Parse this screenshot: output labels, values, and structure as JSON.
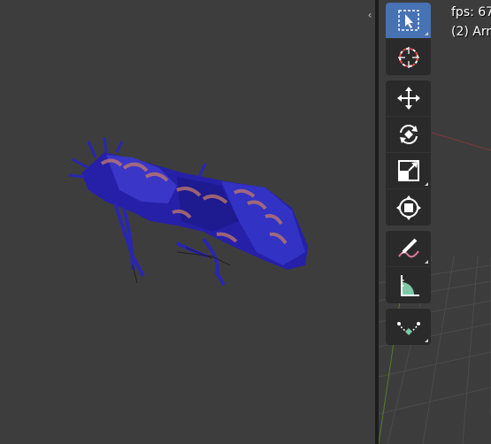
{
  "viewport": {
    "fps_text": "fps: 67",
    "object_text": "(2) Arm"
  },
  "colors": {
    "active_tool": "#4772b3",
    "background": "#3d3d3d",
    "model": "#2a2ab8"
  },
  "toolbar": {
    "tools": [
      {
        "name": "select-box",
        "icon": "select-box-icon",
        "active": true
      },
      {
        "name": "cursor",
        "icon": "cursor-icon",
        "active": false
      },
      {
        "name": "move",
        "icon": "move-icon",
        "active": false
      },
      {
        "name": "rotate",
        "icon": "rotate-icon",
        "active": false
      },
      {
        "name": "scale",
        "icon": "scale-icon",
        "active": false
      },
      {
        "name": "transform",
        "icon": "transform-icon",
        "active": false
      },
      {
        "name": "annotate",
        "icon": "annotate-icon",
        "active": false
      },
      {
        "name": "measure",
        "icon": "measure-icon",
        "active": false
      },
      {
        "name": "add-curve",
        "icon": "curve-icon",
        "active": false
      }
    ]
  }
}
